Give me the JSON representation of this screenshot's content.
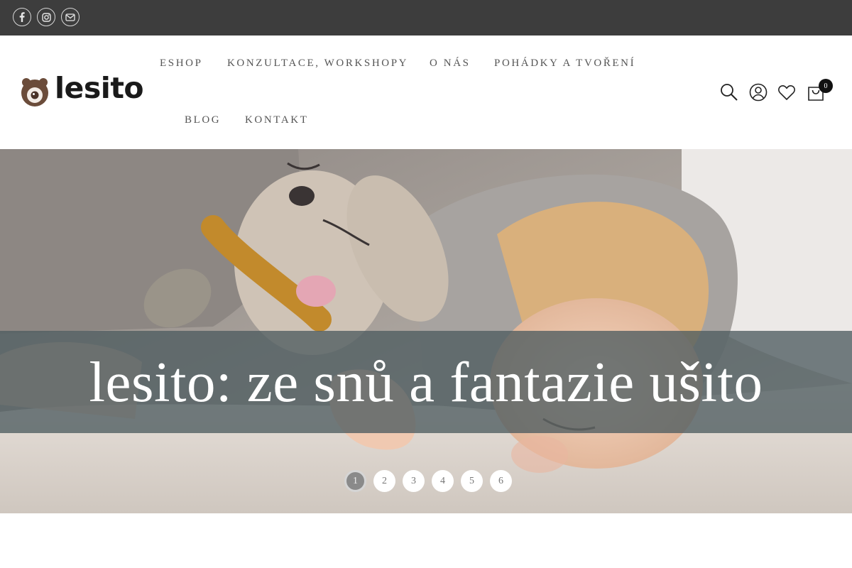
{
  "topbar": {
    "social": [
      {
        "name": "facebook-icon"
      },
      {
        "name": "instagram-icon"
      },
      {
        "name": "email-icon"
      }
    ]
  },
  "brand": {
    "logo_text": "lesito"
  },
  "nav": {
    "items": [
      {
        "label": "ESHOP"
      },
      {
        "label": "KONZULTACE, WORKSHOPY"
      },
      {
        "label": "O NÁS"
      },
      {
        "label": "POHÁDKY A TVOŘENÍ"
      },
      {
        "label": "BLOG"
      },
      {
        "label": "KONTAKT"
      }
    ]
  },
  "header_icons": {
    "search": "search-icon",
    "account": "user-icon",
    "wishlist": "heart-icon",
    "cart": "shopping-bag-icon",
    "cart_count": "0"
  },
  "hero": {
    "caption": "lesito: ze snů a fantazie ušito",
    "pagination": [
      "1",
      "2",
      "3",
      "4",
      "5",
      "6"
    ],
    "active_slide": "1"
  }
}
